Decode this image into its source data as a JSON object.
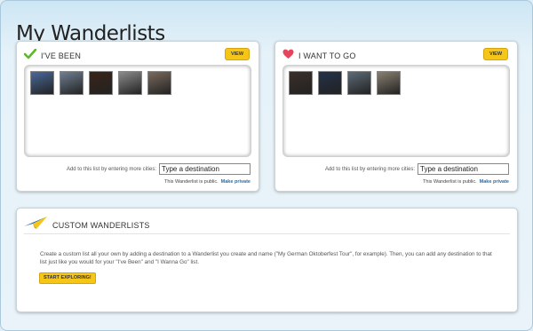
{
  "page": {
    "title": "My Wanderlists"
  },
  "been": {
    "title": "I'VE BEEN",
    "view_label": "VIEW",
    "thumb_colors": [
      "#4a6a9a",
      "#6f7f93",
      "#3a2418",
      "#8c8c8c",
      "#7a6a5c"
    ],
    "add_label": "Add to this list by entering more cities:",
    "input_value": "Type a destination",
    "public_text": "This Wanderlist is public.",
    "private_link": "Make private"
  },
  "go": {
    "title": "I WANT TO GO",
    "view_label": "VIEW",
    "thumb_colors": [
      "#3b2f2a",
      "#23324a",
      "#5d6b78",
      "#8a8070"
    ],
    "add_label": "Add to this list by entering more cities:",
    "input_value": "Type a destination",
    "public_text": "This Wanderlist is public.",
    "private_link": "Make private"
  },
  "custom": {
    "title": "CUSTOM WANDERLISTS",
    "description": "Create a custom list all your own by adding a destination to a Wanderlist you create and name (\"My German Oktoberfest Tour\", for example). Then, you can add any destination to that list just like you would for your \"I've Been\" and \"I Wanna Go\" list.",
    "button_label": "START EXPLORING!"
  },
  "colors": {
    "accent": "#f5c518",
    "link": "#2a6ea6",
    "background": "#dfeef7"
  },
  "icons": {
    "been": "checkmark-icon",
    "go": "heart-icon",
    "custom": "paper-plane-icon"
  }
}
